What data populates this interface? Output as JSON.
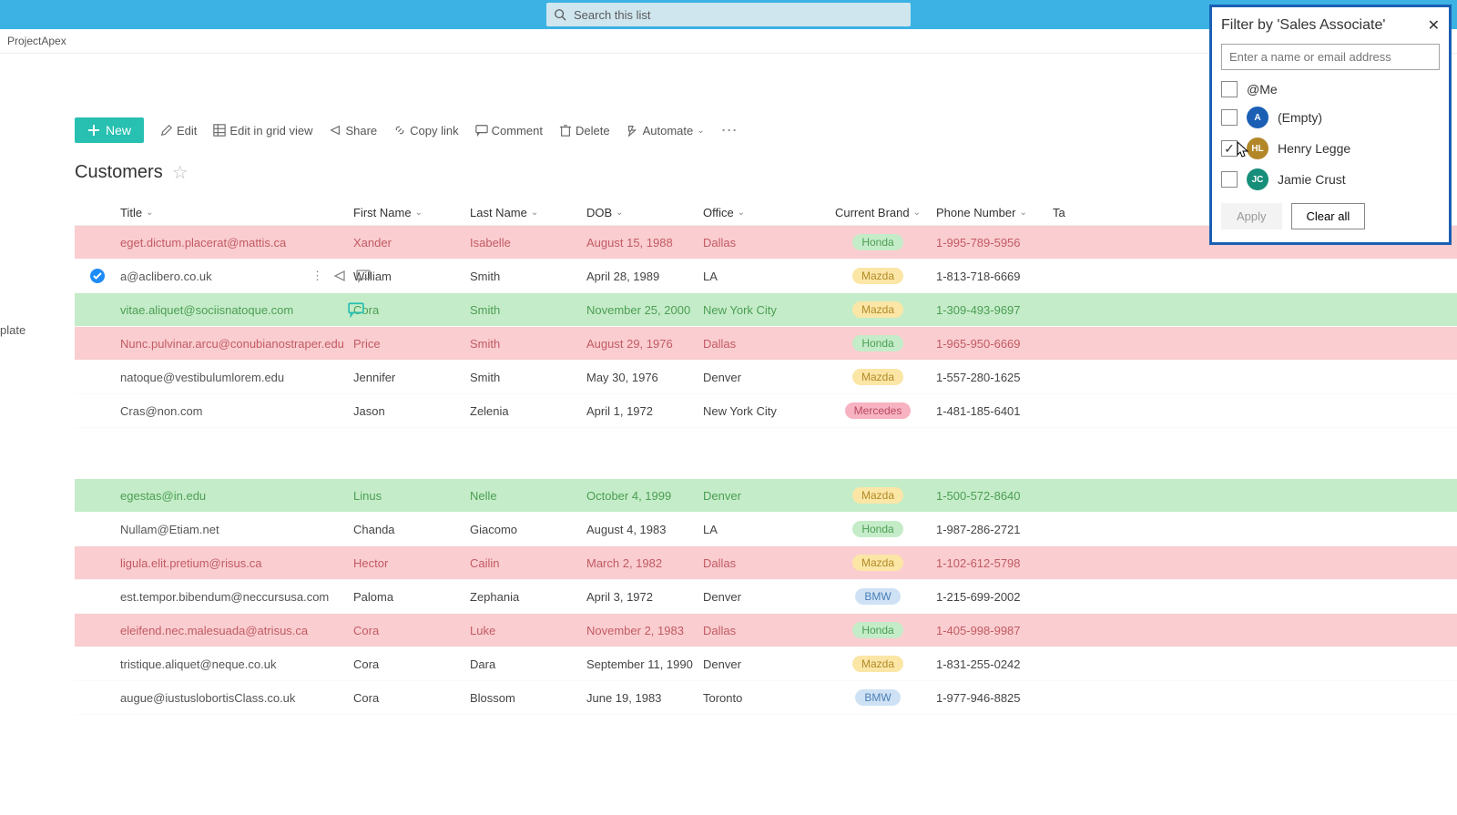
{
  "search": {
    "placeholder": "Search this list"
  },
  "breadcrumb": "ProjectApex",
  "left_sidebar_label": "plate",
  "commands": {
    "new": "New",
    "edit": "Edit",
    "grid": "Edit in grid view",
    "share": "Share",
    "copy": "Copy link",
    "comment": "Comment",
    "delete": "Delete",
    "automate": "Automate"
  },
  "list": {
    "title": "Customers",
    "columns": {
      "title": "Title",
      "first": "First Name",
      "last": "Last Name",
      "dob": "DOB",
      "office": "Office",
      "brand": "Current Brand",
      "phone": "Phone Number",
      "tags": "Ta"
    },
    "rows": [
      {
        "title": "eget.dictum.placerat@mattis.ca",
        "first": "Xander",
        "last": "Isabelle",
        "dob": "August 15, 1988",
        "office": "Dallas",
        "brand": "Honda",
        "phone": "1-995-789-5956",
        "cls": "red"
      },
      {
        "title": "a@aclibero.co.uk",
        "first": "William",
        "last": "Smith",
        "dob": "April 28, 1989",
        "office": "LA",
        "brand": "Mazda",
        "phone": "1-813-718-6669",
        "cls": "sel"
      },
      {
        "title": "vitae.aliquet@sociisnatoque.com",
        "first": "Cora",
        "last": "Smith",
        "dob": "November 25, 2000",
        "office": "New York City",
        "brand": "Mazda",
        "phone": "1-309-493-9697",
        "cls": "green",
        "comment": true
      },
      {
        "title": "Nunc.pulvinar.arcu@conubianostraper.edu",
        "first": "Price",
        "last": "Smith",
        "dob": "August 29, 1976",
        "office": "Dallas",
        "brand": "Honda",
        "phone": "1-965-950-6669",
        "cls": "red"
      },
      {
        "title": "natoque@vestibulumlorem.edu",
        "first": "Jennifer",
        "last": "Smith",
        "dob": "May 30, 1976",
        "office": "Denver",
        "brand": "Mazda",
        "phone": "1-557-280-1625",
        "cls": ""
      },
      {
        "title": "Cras@non.com",
        "first": "Jason",
        "last": "Zelenia",
        "dob": "April 1, 1972",
        "office": "New York City",
        "brand": "Mercedes",
        "phone": "1-481-185-6401",
        "cls": ""
      }
    ],
    "rows2": [
      {
        "title": "egestas@in.edu",
        "first": "Linus",
        "last": "Nelle",
        "dob": "October 4, 1999",
        "office": "Denver",
        "brand": "Mazda",
        "phone": "1-500-572-8640",
        "cls": "green"
      },
      {
        "title": "Nullam@Etiam.net",
        "first": "Chanda",
        "last": "Giacomo",
        "dob": "August 4, 1983",
        "office": "LA",
        "brand": "Honda",
        "phone": "1-987-286-2721",
        "cls": ""
      },
      {
        "title": "ligula.elit.pretium@risus.ca",
        "first": "Hector",
        "last": "Cailin",
        "dob": "March 2, 1982",
        "office": "Dallas",
        "brand": "Mazda",
        "phone": "1-102-612-5798",
        "cls": "red"
      },
      {
        "title": "est.tempor.bibendum@neccursusa.com",
        "first": "Paloma",
        "last": "Zephania",
        "dob": "April 3, 1972",
        "office": "Denver",
        "brand": "BMW",
        "phone": "1-215-699-2002",
        "cls": ""
      },
      {
        "title": "eleifend.nec.malesuada@atrisus.ca",
        "first": "Cora",
        "last": "Luke",
        "dob": "November 2, 1983",
        "office": "Dallas",
        "brand": "Honda",
        "phone": "1-405-998-9987",
        "cls": "red"
      },
      {
        "title": "tristique.aliquet@neque.co.uk",
        "first": "Cora",
        "last": "Dara",
        "dob": "September 11, 1990",
        "office": "Denver",
        "brand": "Mazda",
        "phone": "1-831-255-0242",
        "cls": ""
      },
      {
        "title": "augue@iustuslobortisClass.co.uk",
        "first": "Cora",
        "last": "Blossom",
        "dob": "June 19, 1983",
        "office": "Toronto",
        "brand": "BMW",
        "phone": "1-977-946-8825",
        "cls": ""
      }
    ]
  },
  "filter": {
    "title": "Filter by 'Sales Associate'",
    "placeholder": "Enter a name or email address",
    "items": [
      {
        "label": "@Me",
        "avatar": null,
        "color": null,
        "checked": false
      },
      {
        "label": "(Empty)",
        "avatar": "A",
        "color": "#1a5fb4",
        "checked": false
      },
      {
        "label": "Henry Legge",
        "avatar": "HL",
        "color": "#b38728",
        "checked": true,
        "cursor": true
      },
      {
        "label": "Jamie Crust",
        "avatar": "JC",
        "color": "#178e7a",
        "checked": false
      }
    ],
    "apply": "Apply",
    "clear": "Clear all"
  }
}
